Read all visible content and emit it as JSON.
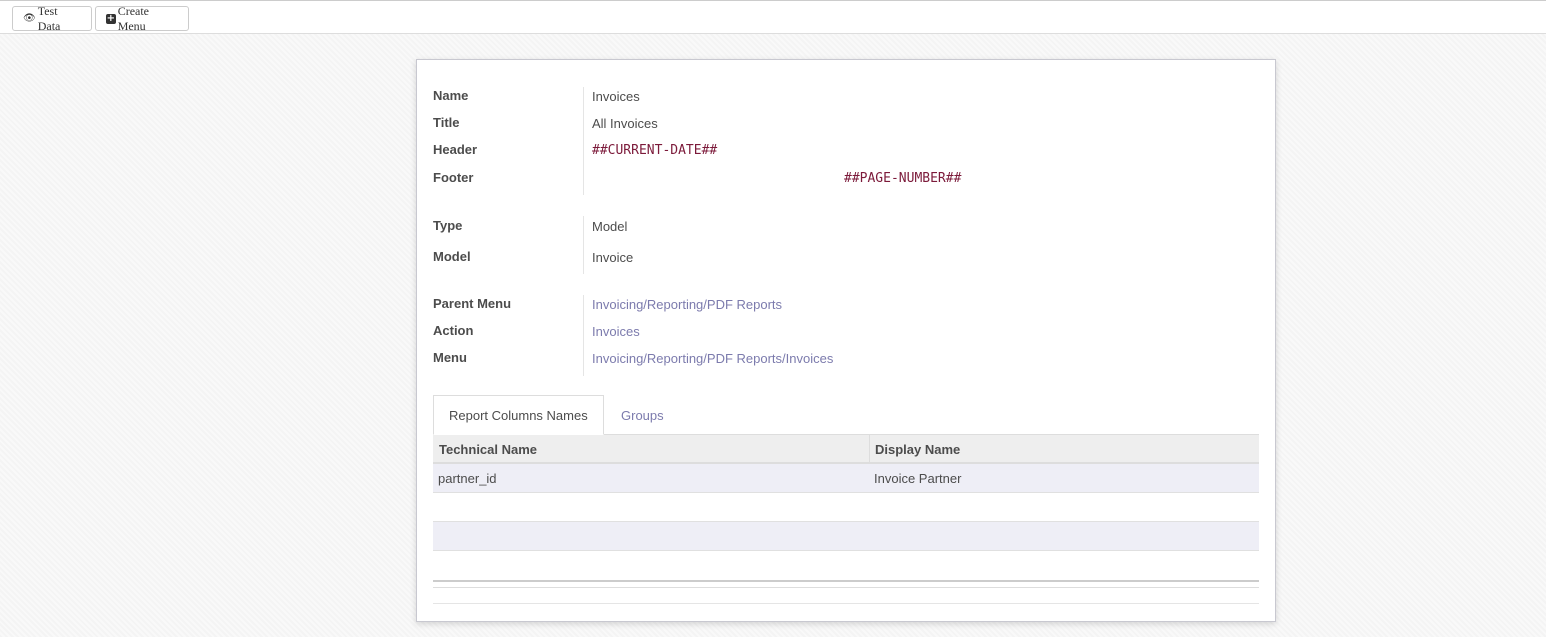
{
  "toolbar": {
    "test_data_label": "Test Data",
    "create_menu_label": "Create Menu"
  },
  "form": {
    "name_label": "Name",
    "name_value": "Invoices",
    "title_label": "Title",
    "title_value": "All Invoices",
    "header_label": "Header",
    "header_value": "##CURRENT-DATE##",
    "footer_label": "Footer",
    "footer_value": "##PAGE-NUMBER##",
    "type_label": "Type",
    "type_value": "Model",
    "model_label": "Model",
    "model_value": "Invoice",
    "parent_menu_label": "Parent Menu",
    "parent_menu_value": "Invoicing/Reporting/PDF Reports",
    "action_label": "Action",
    "action_value": "Invoices",
    "menu_label": "Menu",
    "menu_value": "Invoicing/Reporting/PDF Reports/Invoices"
  },
  "tabs": [
    {
      "label": "Report Columns Names",
      "active": true
    },
    {
      "label": "Groups",
      "active": false
    }
  ],
  "grid": {
    "headers": [
      "Technical Name",
      "Display Name"
    ],
    "rows": [
      [
        "partner_id",
        "Invoice Partner"
      ],
      [
        "",
        ""
      ],
      [
        "",
        ""
      ],
      [
        "",
        ""
      ]
    ]
  },
  "colors": {
    "link": "#7c7bad",
    "mono_text": "#7c1a3a",
    "row_stripe": "#eeeef6"
  }
}
